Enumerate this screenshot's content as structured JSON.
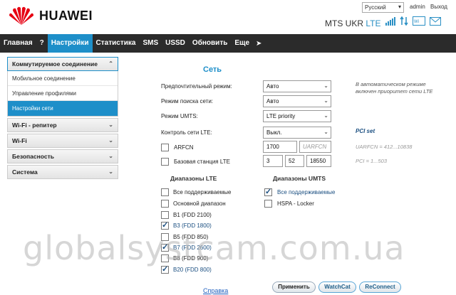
{
  "header": {
    "brand": "HUAWEI",
    "language": "Русский",
    "admin": "admin",
    "logout": "Выход",
    "operator": "MTS UKR",
    "network_type": "LTE",
    "icons": [
      "signal-icon",
      "transfer-icon",
      "wifi-icon",
      "message-icon"
    ]
  },
  "nav": {
    "items": [
      "Главная",
      "?",
      "Настройки",
      "Статистика",
      "SMS",
      "USSD",
      "Обновить",
      "Еще"
    ],
    "active": "Настройки"
  },
  "sidebar": {
    "groups": [
      {
        "label": "Коммутируемое соединение",
        "sub": [
          "Мобильное соединение",
          "Управление профилями",
          "Настройки сети"
        ]
      },
      {
        "label": "Wi-Fi - репитер"
      },
      {
        "label": "Wi-Fi"
      },
      {
        "label": "Безопасность"
      },
      {
        "label": "Система"
      }
    ]
  },
  "main": {
    "title": "Сеть",
    "preferred_mode_label": "Предпочтительный режим:",
    "preferred_mode_value": "Авто",
    "search_mode_label": "Режим поиска сети:",
    "search_mode_value": "Авто",
    "umts_mode_label": "Режим UMTS:",
    "umts_mode_value": "LTE priority",
    "lte_control_label": "Контроль сети LTE:",
    "lte_control_value": "Выкл.",
    "arfcn_label": "ARFCN",
    "arfcn_value": "1700",
    "arfcn_placeholder": "UARFCN",
    "base_station_label": "Базовая станция LTE",
    "base_station_values": [
      "3",
      "52",
      "18550"
    ],
    "hint_line1": "В автоматическом режиме",
    "hint_line2": "включен приоритет сети LTE",
    "pci_set": "PCI set",
    "uarfcn_hint": "UARFCN = 412...10838",
    "pci_hint": "PCI = 1...503",
    "lte_bands_title": "Диапазоны LTE",
    "umts_bands_title": "Диапазоны UMTS",
    "lte_bands": [
      {
        "label": "Все поддерживаемые",
        "checked": false
      },
      {
        "label": "Основной диапазон",
        "checked": false
      },
      {
        "label": "B1 (FDD 2100)",
        "checked": false
      },
      {
        "label": "B3 (FDD 1800)",
        "checked": true
      },
      {
        "label": "B5 (FDD 850)",
        "checked": false
      },
      {
        "label": "B7 (FDD 2600)",
        "checked": true
      },
      {
        "label": "B8 (FDD 900)",
        "checked": false
      },
      {
        "label": "B20 (FDD 800)",
        "checked": true
      }
    ],
    "umts_bands": [
      {
        "label": "Все поддерживаемые",
        "checked": true
      },
      {
        "label": "HSPA - Locker",
        "checked": false
      }
    ],
    "help_link": "Справка",
    "btn_apply": "Применить",
    "btn_watchcat": "WatchCat",
    "btn_reconnect": "ReConnect"
  },
  "watermark": "globalsystcam.com.ua"
}
